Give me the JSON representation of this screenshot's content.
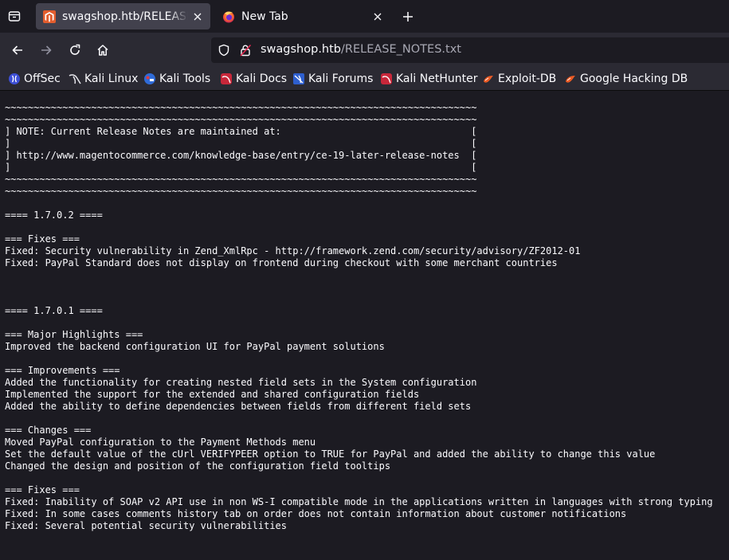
{
  "browser": {
    "tabs": [
      {
        "title": "swagshop.htb/RELEASE_NOTES.txt",
        "active": true,
        "favicon": "magento-icon"
      },
      {
        "title": "New Tab",
        "active": false,
        "favicon": "firefox-icon"
      }
    ],
    "url": {
      "host": "swagshop.htb",
      "path": "/RELEASE_NOTES.txt"
    },
    "bookmarks": [
      {
        "label": "OffSec",
        "icon": "offsec-icon"
      },
      {
        "label": "Kali Linux",
        "icon": "kali-dragon-icon"
      },
      {
        "label": "Kali Tools",
        "icon": "kali-tools-icon"
      },
      {
        "label": "Kali Docs",
        "icon": "kali-docs-icon"
      },
      {
        "label": "Kali Forums",
        "icon": "kali-forums-icon"
      },
      {
        "label": "Kali NetHunter",
        "icon": "kali-nethunter-icon"
      },
      {
        "label": "Exploit-DB",
        "icon": "exploit-db-icon"
      },
      {
        "label": "Google Hacking DB",
        "icon": "ghdb-icon"
      }
    ]
  },
  "document": {
    "lines": [
      "~~~~~~~~~~~~~~~~~~~~~~~~~~~~~~~~~~~~~~~~~~~~~~~~~~~~~~~~~~~~~~~~~~~~~~~~~~~~~~~~~~",
      "~~~~~~~~~~~~~~~~~~~~~~~~~~~~~~~~~~~~~~~~~~~~~~~~~~~~~~~~~~~~~~~~~~~~~~~~~~~~~~~~~~",
      "] NOTE: Current Release Notes are maintained at:                                 [",
      "]                                                                                [",
      "] http://www.magentocommerce.com/knowledge-base/entry/ce-19-later-release-notes  [",
      "]                                                                                [",
      "~~~~~~~~~~~~~~~~~~~~~~~~~~~~~~~~~~~~~~~~~~~~~~~~~~~~~~~~~~~~~~~~~~~~~~~~~~~~~~~~~~",
      "~~~~~~~~~~~~~~~~~~~~~~~~~~~~~~~~~~~~~~~~~~~~~~~~~~~~~~~~~~~~~~~~~~~~~~~~~~~~~~~~~~",
      "",
      "==== 1.7.0.2 ====",
      "",
      "=== Fixes ===",
      "Fixed: Security vulnerability in Zend_XmlRpc - http://framework.zend.com/security/advisory/ZF2012-01",
      "Fixed: PayPal Standard does not display on frontend during checkout with some merchant countries",
      "",
      "",
      "",
      "==== 1.7.0.1 ====",
      "",
      "=== Major Highlights ===",
      "Improved the backend configuration UI for PayPal payment solutions",
      "",
      "=== Improvements ===",
      "Added the functionality for creating nested field sets in the System configuration",
      "Implemented the support for the extended and shared configuration fields",
      "Added the ability to define dependencies between fields from different field sets",
      "",
      "=== Changes ===",
      "Moved PayPal configuration to the Payment Methods menu",
      "Set the default value of the cUrl VERIFYPEER option to TRUE for PayPal and added the ability to change this value",
      "Changed the design and position of the configuration field tooltips",
      "",
      "=== Fixes ===",
      "Fixed: Inability of SOAP v2 API use in non WS-I compatible mode in the applications written in languages with strong typing",
      "Fixed: In some cases comments history tab on order does not contain information about customer notifications",
      "Fixed: Several potential security vulnerabilities"
    ]
  },
  "colors": {
    "chrome_bg": "#1c1b22",
    "toolbar_bg": "#2b2a33",
    "active_tab": "#42414d",
    "text": "#fbfbfe",
    "url_path": "#a8a8b3"
  }
}
